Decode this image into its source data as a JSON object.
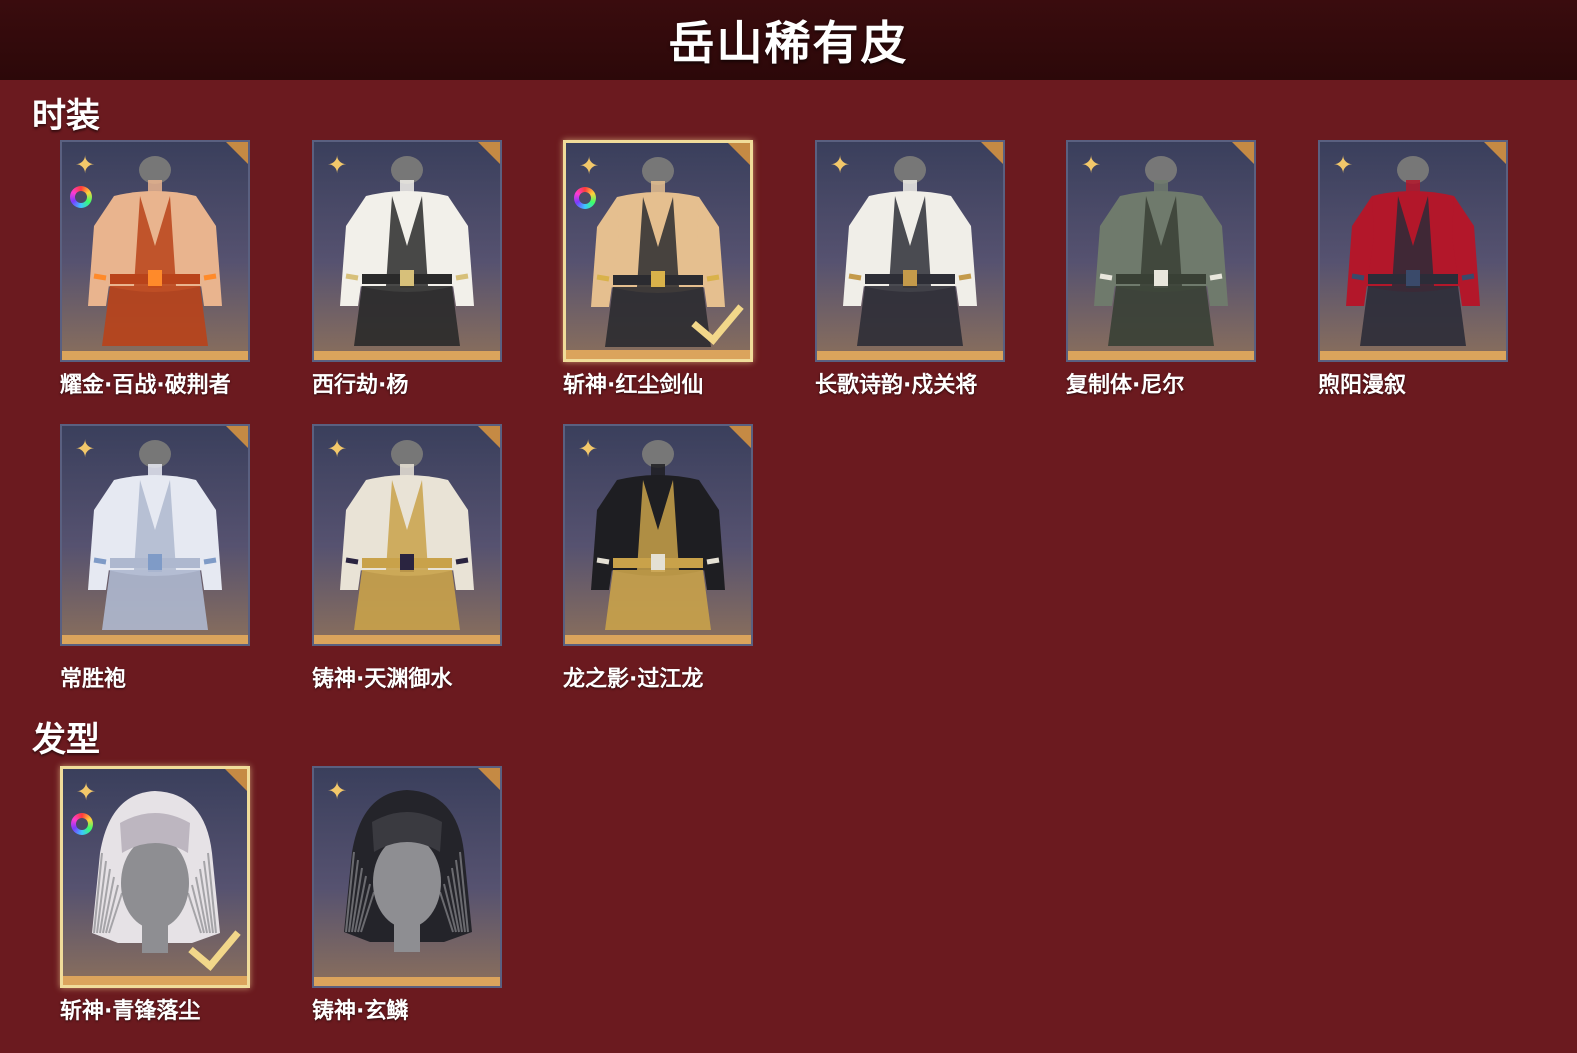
{
  "header": {
    "title": "岳山稀有皮"
  },
  "sections": {
    "fashion": {
      "title": "时装",
      "items": [
        {
          "name": "耀金·百战·破荆者",
          "selected": false,
          "dye": true,
          "palette": [
            "#e9b48e",
            "#b9431a",
            "#ff8a2a"
          ]
        },
        {
          "name": "西行劫·杨",
          "selected": false,
          "dye": false,
          "palette": [
            "#f2f0ea",
            "#2a2a2a",
            "#d7c07a"
          ]
        },
        {
          "name": "斩神·红尘剑仙",
          "selected": true,
          "dye": true,
          "palette": [
            "#e5bf8f",
            "#2b2b30",
            "#d9b24a"
          ]
        },
        {
          "name": "长歌诗韵·戍关将",
          "selected": false,
          "dye": false,
          "palette": [
            "#f0eee8",
            "#2d2e36",
            "#c49a4a"
          ]
        },
        {
          "name": "复制体·尼尔",
          "selected": false,
          "dye": false,
          "palette": [
            "#6f7a6c",
            "#394035",
            "#e8e6dc"
          ]
        },
        {
          "name": "煦阳漫叙",
          "selected": false,
          "dye": false,
          "palette": [
            "#b3172a",
            "#2c2c38",
            "#3a4a6a"
          ]
        },
        {
          "name": "常胜袍",
          "selected": false,
          "dye": false,
          "palette": [
            "#e6e9f2",
            "#aeb8cf",
            "#7f9bc7"
          ]
        },
        {
          "name": "铸神·天渊御水",
          "selected": false,
          "dye": false,
          "palette": [
            "#e9e3d6",
            "#c9a24a",
            "#2a2440"
          ]
        },
        {
          "name": "龙之影·过江龙",
          "selected": false,
          "dye": false,
          "palette": [
            "#1e1e22",
            "#c9a24a",
            "#e4e0d4"
          ]
        }
      ]
    },
    "hair": {
      "title": "发型",
      "items": [
        {
          "name": "斩神·青锋落尘",
          "selected": true,
          "dye": true,
          "palette": [
            "#e6e2e6",
            "#bdb6c0",
            "#8a8a8e"
          ]
        },
        {
          "name": "铸神·玄鳞",
          "selected": false,
          "dye": false,
          "palette": [
            "#24242a",
            "#3a3a40",
            "#8a8a8e"
          ]
        }
      ]
    }
  },
  "icons": {
    "quality": "flower-quality-icon",
    "dye": "dye-color-wheel-icon",
    "check": "checkmark-icon"
  }
}
